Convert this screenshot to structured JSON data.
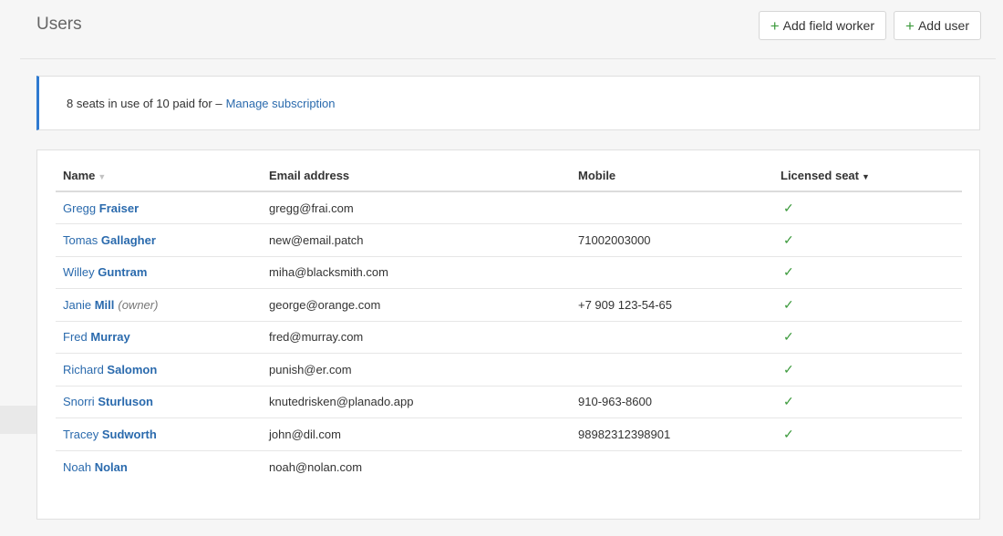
{
  "page": {
    "title": "Users"
  },
  "header": {
    "add_field_worker_label": "Add field worker",
    "add_user_label": "Add user"
  },
  "subscription": {
    "text": "8 seats in use of 10 paid for –",
    "link_label": "Manage subscription",
    "seats_in_use": 8,
    "seats_paid": 10
  },
  "table": {
    "columns": [
      "Name",
      "Email address",
      "Mobile",
      "Licensed seat"
    ],
    "sort": {
      "name": "inactive",
      "licensed_seat": "descending"
    },
    "rows": [
      {
        "first": "Gregg",
        "last": "Fraiser",
        "role": "",
        "email": "gregg@frai.com",
        "mobile": "",
        "licensed": true
      },
      {
        "first": "Tomas",
        "last": "Gallagher",
        "role": "",
        "email": "new@email.patch",
        "mobile": "71002003000",
        "licensed": true
      },
      {
        "first": "Willey",
        "last": "Guntram",
        "role": "",
        "email": "miha@blacksmith.com",
        "mobile": "",
        "licensed": true
      },
      {
        "first": "Janie",
        "last": "Mill",
        "role": "(owner)",
        "email": "george@orange.com",
        "mobile": "+7 909 123-54-65",
        "licensed": true
      },
      {
        "first": "Fred",
        "last": "Murray",
        "role": "",
        "email": "fred@murray.com",
        "mobile": "",
        "licensed": true
      },
      {
        "first": "Richard",
        "last": "Salomon",
        "role": "",
        "email": "punish@er.com",
        "mobile": "",
        "licensed": true
      },
      {
        "first": "Snorri",
        "last": "Sturluson",
        "role": "",
        "email": "knutedrisken@planado.app",
        "mobile": "910-963-8600",
        "licensed": true
      },
      {
        "first": "Tracey",
        "last": "Sudworth",
        "role": "",
        "email": "john@dil.com",
        "mobile": "98982312398901",
        "licensed": true
      },
      {
        "first": "Noah",
        "last": "Nolan",
        "role": "",
        "email": "noah@nolan.com",
        "mobile": "",
        "licensed": false
      }
    ]
  },
  "icons": {
    "add": "plus-icon",
    "licensed": "check-icon",
    "sort_idle": "sort-down-icon",
    "sort_active": "caret-down-icon"
  },
  "colors": {
    "accent": "#2f7ad0",
    "link": "#2a6aad",
    "success": "#3c9a3c"
  }
}
